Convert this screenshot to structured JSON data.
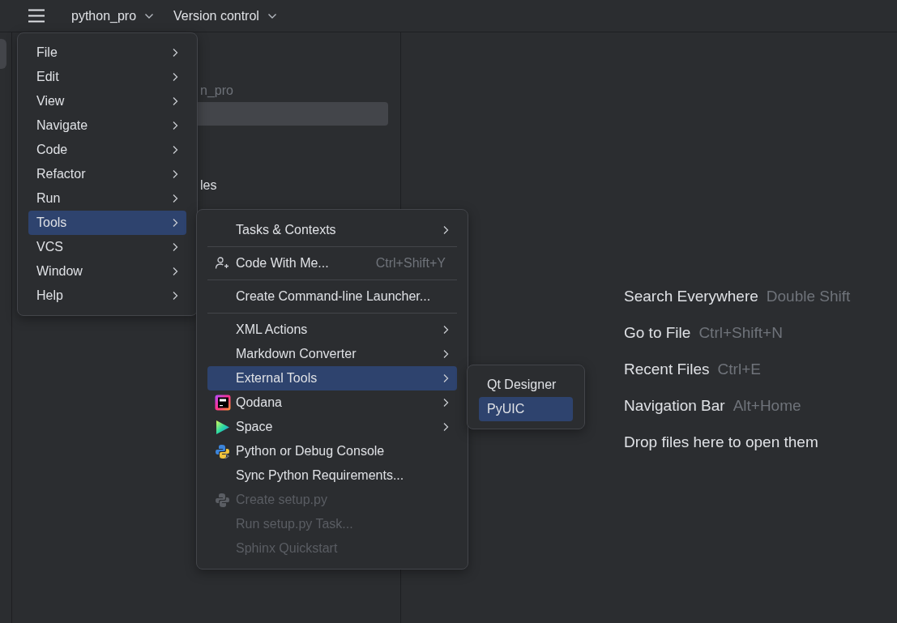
{
  "toolbar": {
    "project": "python_pro",
    "vcs": "Version control"
  },
  "project_panel": {
    "path_fragment": "n_pro",
    "item_fragment": "les"
  },
  "main_menu": {
    "items": [
      {
        "label": "File",
        "selected": false
      },
      {
        "label": "Edit",
        "selected": false
      },
      {
        "label": "View",
        "selected": false
      },
      {
        "label": "Navigate",
        "selected": false
      },
      {
        "label": "Code",
        "selected": false
      },
      {
        "label": "Refactor",
        "selected": false
      },
      {
        "label": "Run",
        "selected": false
      },
      {
        "label": "Tools",
        "selected": true
      },
      {
        "label": "VCS",
        "selected": false
      },
      {
        "label": "Window",
        "selected": false
      },
      {
        "label": "Help",
        "selected": false
      }
    ]
  },
  "tools_menu": {
    "items": [
      {
        "kind": "submenu",
        "label": "Tasks & Contexts",
        "selected": false,
        "disabled": false
      },
      {
        "kind": "separator"
      },
      {
        "kind": "action",
        "label": "Code With Me...",
        "shortcut": "Ctrl+Shift+Y",
        "selected": false,
        "disabled": false
      },
      {
        "kind": "separator"
      },
      {
        "kind": "action",
        "label": "Create Command-line Launcher...",
        "selected": false,
        "disabled": false
      },
      {
        "kind": "separator"
      },
      {
        "kind": "submenu",
        "label": "XML Actions",
        "selected": false,
        "disabled": false
      },
      {
        "kind": "submenu",
        "label": "Markdown Converter",
        "selected": false,
        "disabled": false
      },
      {
        "kind": "submenu",
        "label": "External Tools",
        "selected": true,
        "disabled": false
      },
      {
        "kind": "submenu",
        "label": "Qodana",
        "selected": false,
        "disabled": false
      },
      {
        "kind": "submenu",
        "label": "Space",
        "selected": false,
        "disabled": false
      },
      {
        "kind": "action",
        "label": "Python or Debug Console",
        "selected": false,
        "disabled": false
      },
      {
        "kind": "action",
        "label": "Sync Python Requirements...",
        "selected": false,
        "disabled": false
      },
      {
        "kind": "action",
        "label": "Create setup.py",
        "selected": false,
        "disabled": true
      },
      {
        "kind": "action",
        "label": "Run setup.py Task...",
        "selected": false,
        "disabled": true
      },
      {
        "kind": "action",
        "label": "Sphinx Quickstart",
        "selected": false,
        "disabled": true
      }
    ]
  },
  "external_tools_menu": {
    "items": [
      {
        "label": "Qt Designer",
        "selected": false
      },
      {
        "label": "PyUIC",
        "selected": true
      }
    ]
  },
  "editor_hints": [
    {
      "action": "Search Everywhere",
      "shortcut": "Double Shift"
    },
    {
      "action": "Go to File",
      "shortcut": "Ctrl+Shift+N"
    },
    {
      "action": "Recent Files",
      "shortcut": "Ctrl+E"
    },
    {
      "action": "Navigation Bar",
      "shortcut": "Alt+Home"
    },
    {
      "action": "Drop files here to open them"
    }
  ]
}
